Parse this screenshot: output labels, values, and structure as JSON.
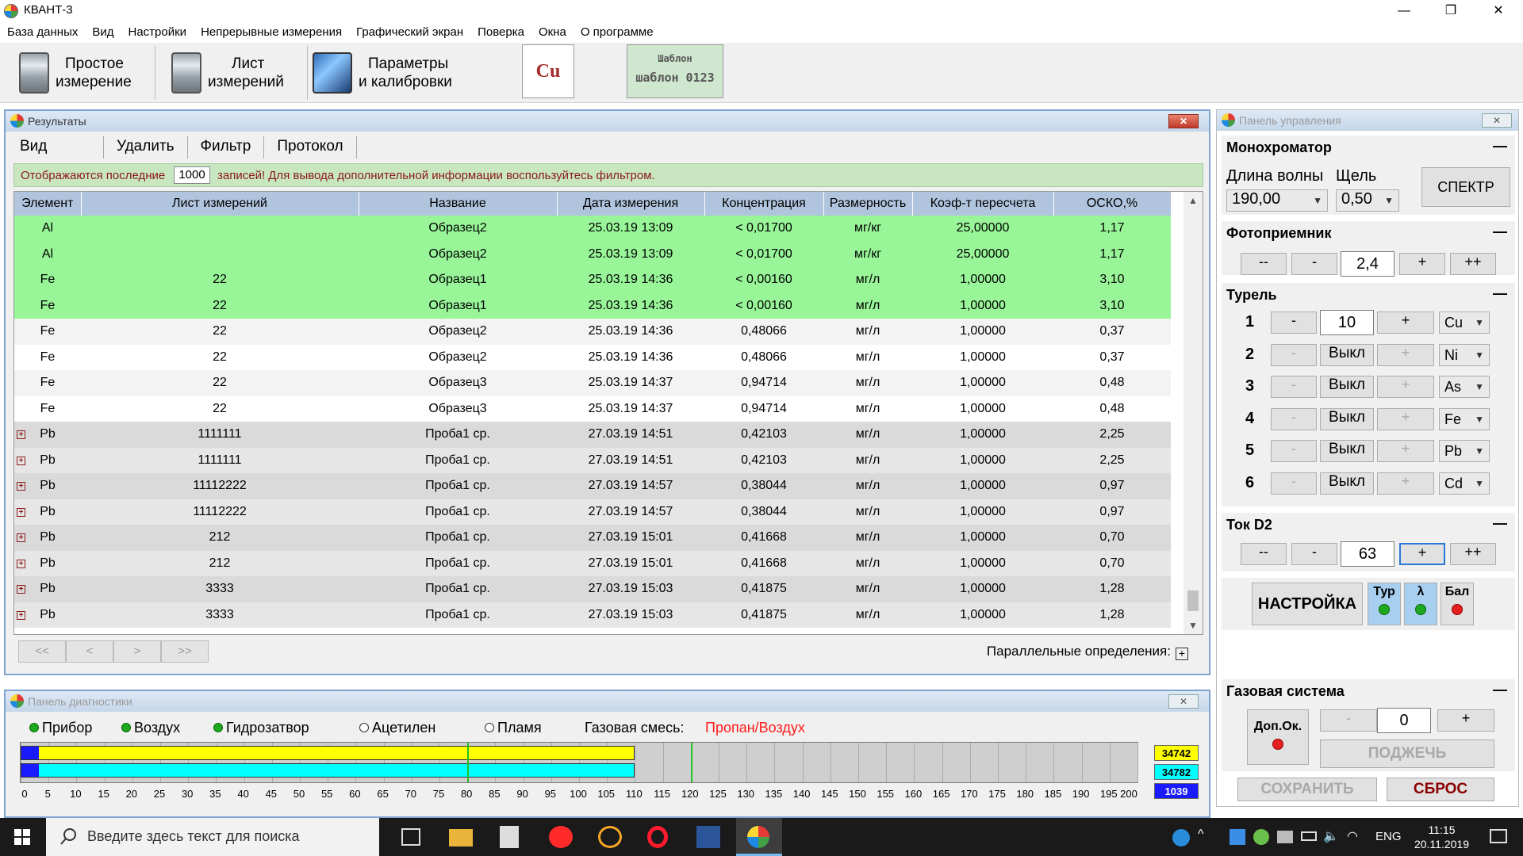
{
  "window": {
    "title": "КВАНТ-3",
    "minimize": "—",
    "maximize": "❐",
    "close": "✕"
  },
  "menu": [
    "База данных",
    "Вид",
    "Настройки",
    "Непрерывные измерения",
    "Графический экран",
    "Поверка",
    "Окна",
    "О программе"
  ],
  "toolbar": {
    "simple": {
      "line1": "Простое",
      "line2": "измерение"
    },
    "sheet": {
      "line1": "Лист",
      "line2": "измерений"
    },
    "params": {
      "line1": "Параметры",
      "line2": "и калибровки"
    },
    "element": "Cu",
    "template_caption": "Шаблон",
    "template_name": "шаблон 0123"
  },
  "results": {
    "title": "Результаты",
    "close": "✕",
    "menu": [
      "Вид",
      "Удалить",
      "Фильтр",
      "Протокол"
    ],
    "notice_before": "Отображаются последние",
    "notice_count": "1000",
    "notice_after": "записей! Для вывода дополнительной информации воспользуйтесь фильтром.",
    "columns": [
      "Элемент",
      "Лист измерений",
      "Название",
      "Дата измерения",
      "Концентрация",
      "Размерность",
      "Коэф-т пересчета",
      "ОСКО,%"
    ],
    "rows": [
      [
        "Al",
        "",
        "Образец2",
        "25.03.19 13:09",
        "< 0,01700",
        "мг/кг",
        "25,00000",
        "1,17"
      ],
      [
        "Al",
        "",
        "Образец2",
        "25.03.19 13:09",
        "< 0,01700",
        "мг/кг",
        "25,00000",
        "1,17"
      ],
      [
        "Fe",
        "22",
        "Образец1",
        "25.03.19 14:36",
        "< 0,00160",
        "мг/л",
        "1,00000",
        "3,10"
      ],
      [
        "Fe",
        "22",
        "Образец1",
        "25.03.19 14:36",
        "< 0,00160",
        "мг/л",
        "1,00000",
        "3,10"
      ],
      [
        "Fe",
        "22",
        "Образец2",
        "25.03.19 14:36",
        "0,48066",
        "мг/л",
        "1,00000",
        "0,37"
      ],
      [
        "Fe",
        "22",
        "Образец2",
        "25.03.19 14:36",
        "0,48066",
        "мг/л",
        "1,00000",
        "0,37"
      ],
      [
        "Fe",
        "22",
        "Образец3",
        "25.03.19 14:37",
        "0,94714",
        "мг/л",
        "1,00000",
        "0,48"
      ],
      [
        "Fe",
        "22",
        "Образец3",
        "25.03.19 14:37",
        "0,94714",
        "мг/л",
        "1,00000",
        "0,48"
      ],
      [
        "Pb",
        "1111111",
        "Проба1 ср.",
        "27.03.19 14:51",
        "0,42103",
        "мг/л",
        "1,00000",
        "2,25"
      ],
      [
        "Pb",
        "1111111",
        "Проба1 ср.",
        "27.03.19 14:51",
        "0,42103",
        "мг/л",
        "1,00000",
        "2,25"
      ],
      [
        "Pb",
        "11112222",
        "Проба1 ср.",
        "27.03.19 14:57",
        "0,38044",
        "мг/л",
        "1,00000",
        "0,97"
      ],
      [
        "Pb",
        "11112222",
        "Проба1 ср.",
        "27.03.19 14:57",
        "0,38044",
        "мг/л",
        "1,00000",
        "0,97"
      ],
      [
        "Pb",
        "212",
        "Проба1 ср.",
        "27.03.19 15:01",
        "0,41668",
        "мг/л",
        "1,00000",
        "0,70"
      ],
      [
        "Pb",
        "212",
        "Проба1 ср.",
        "27.03.19 15:01",
        "0,41668",
        "мг/л",
        "1,00000",
        "0,70"
      ],
      [
        "Pb",
        "3333",
        "Проба1 ср.",
        "27.03.19 15:03",
        "0,41875",
        "мг/л",
        "1,00000",
        "1,28"
      ],
      [
        "Pb",
        "3333",
        "Проба1 ср.",
        "27.03.19 15:03",
        "0,41875",
        "мг/л",
        "1,00000",
        "1,28"
      ]
    ],
    "row_styles": [
      "g",
      "g",
      "g",
      "g",
      "w1",
      "w2",
      "w1",
      "w2",
      "d1",
      "d2",
      "d1",
      "d2",
      "d1",
      "d2",
      "d1",
      "d2"
    ],
    "row_expand": [
      false,
      false,
      false,
      false,
      false,
      false,
      false,
      false,
      true,
      true,
      true,
      true,
      true,
      true,
      true,
      true
    ],
    "pager": [
      "<<",
      "<",
      ">",
      ">>"
    ],
    "parallel_label": "Параллельные определения:",
    "parallel_btn": "+"
  },
  "diagnostics": {
    "title": "Панель диагностики",
    "close": "✕",
    "indicators": [
      {
        "label": "Прибор",
        "on": true
      },
      {
        "label": "Воздух",
        "on": true
      },
      {
        "label": "Гидрозатвор",
        "on": true
      },
      {
        "label": "Ацетилен",
        "on": false
      },
      {
        "label": "Пламя",
        "on": false
      }
    ],
    "gas_label": "Газовая смесь:",
    "gas_value": "Пропан/Воздух",
    "scale": [
      "0",
      "5",
      "10",
      "15",
      "20",
      "25",
      "30",
      "35",
      "40",
      "45",
      "50",
      "55",
      "60",
      "65",
      "70",
      "75",
      "80",
      "85",
      "90",
      "95",
      "100",
      "105",
      "110",
      "115",
      "120",
      "125",
      "130",
      "135",
      "140",
      "145",
      "150",
      "155",
      "160",
      "165",
      "170",
      "175",
      "180",
      "185",
      "190",
      "195",
      "200"
    ],
    "bar_yellow": 110,
    "bar_cyan": 110,
    "marker_bar": 80,
    "marker_green": 120,
    "value_yellow": "34742",
    "value_cyan": "34782",
    "value_blue": "1039",
    "colors": {
      "yellow": "#ffff00",
      "cyan": "#00ffff",
      "blue": "#1a1aff",
      "green": "#22c022"
    }
  },
  "control": {
    "title": "Панель управления",
    "close": "✕",
    "mono": {
      "title": "Монохроматор",
      "wave_label": "Длина волны",
      "slit_label": "Щель",
      "wave": "190,00",
      "slit": "0,50",
      "spectrum": "СПЕКТР"
    },
    "photo": {
      "title": "Фотоприемник",
      "mm": "--",
      "m": "-",
      "value": "2,4",
      "p": "+",
      "pp": "++"
    },
    "turret": {
      "title": "Турель",
      "rows": [
        {
          "n": "1",
          "value": "10",
          "el": "Cu",
          "active": true
        },
        {
          "n": "2",
          "value": "Выкл",
          "el": "Ni",
          "active": false
        },
        {
          "n": "3",
          "value": "Выкл",
          "el": "As",
          "active": false
        },
        {
          "n": "4",
          "value": "Выкл",
          "el": "Fe",
          "active": false
        },
        {
          "n": "5",
          "value": "Выкл",
          "el": "Pb",
          "active": false
        },
        {
          "n": "6",
          "value": "Выкл",
          "el": "Cd",
          "active": false
        }
      ],
      "minus": "-",
      "plus": "+"
    },
    "d2": {
      "title": "Ток D2",
      "mm": "--",
      "m": "-",
      "value": "63",
      "p": "+",
      "pp": "++"
    },
    "setup": {
      "label": "НАСТРОЙКА",
      "tur": "Тур",
      "lambda": "λ",
      "bal": "Бал"
    },
    "gas": {
      "title": "Газовая система",
      "extra": "Доп.Ок.",
      "minus": "-",
      "value": "0",
      "plus": "+",
      "ignite": "ПОДЖЕЧЬ"
    },
    "save": "СОХРАНИТЬ",
    "reset": "СБРОС",
    "collapse": "—"
  },
  "taskbar": {
    "search_placeholder": "Введите здесь текст для поиска",
    "lang": "ENG",
    "time": "11:15",
    "date": "20.11.2019"
  }
}
